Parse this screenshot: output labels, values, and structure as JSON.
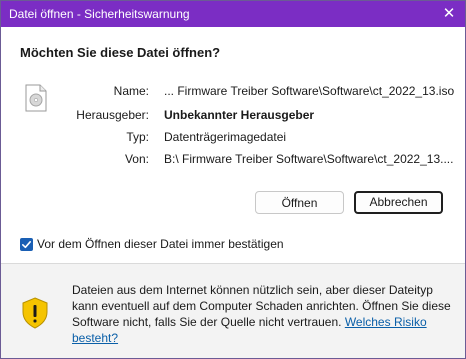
{
  "window": {
    "title": "Datei öffnen - Sicherheitswarnung"
  },
  "heading": "Möchten Sie diese Datei öffnen?",
  "file_icon": "disc-image-file-icon",
  "details": [
    {
      "label": "Name:",
      "value": "... Firmware Treiber Software\\Software\\ct_2022_13.iso"
    },
    {
      "label": "Herausgeber:",
      "value": "Unbekannter Herausgeber"
    },
    {
      "label": "Typ:",
      "value": "Datenträgerimagedatei"
    },
    {
      "label": "Von:",
      "value": "B:\\ Firmware Treiber Software\\Software\\ct_2022_13...."
    }
  ],
  "buttons": {
    "open": "Öffnen",
    "cancel": "Abbrechen"
  },
  "checkbox": {
    "label": "Vor dem Öffnen dieser Datei immer bestätigen",
    "checked": true
  },
  "warning": {
    "icon": "shield-warning-icon",
    "text": "Dateien aus dem Internet können nützlich sein, aber dieser Dateityp kann eventuell auf dem Computer Schaden anrichten. Öffnen Sie diese Software nicht, falls Sie der Quelle nicht vertrauen.",
    "link": "Welches Risiko besteht?"
  },
  "colors": {
    "titlebar": "#7b2dc4",
    "checkbox": "#1a5fb4",
    "link": "#0a5fa8",
    "shield": "#f5c400"
  }
}
